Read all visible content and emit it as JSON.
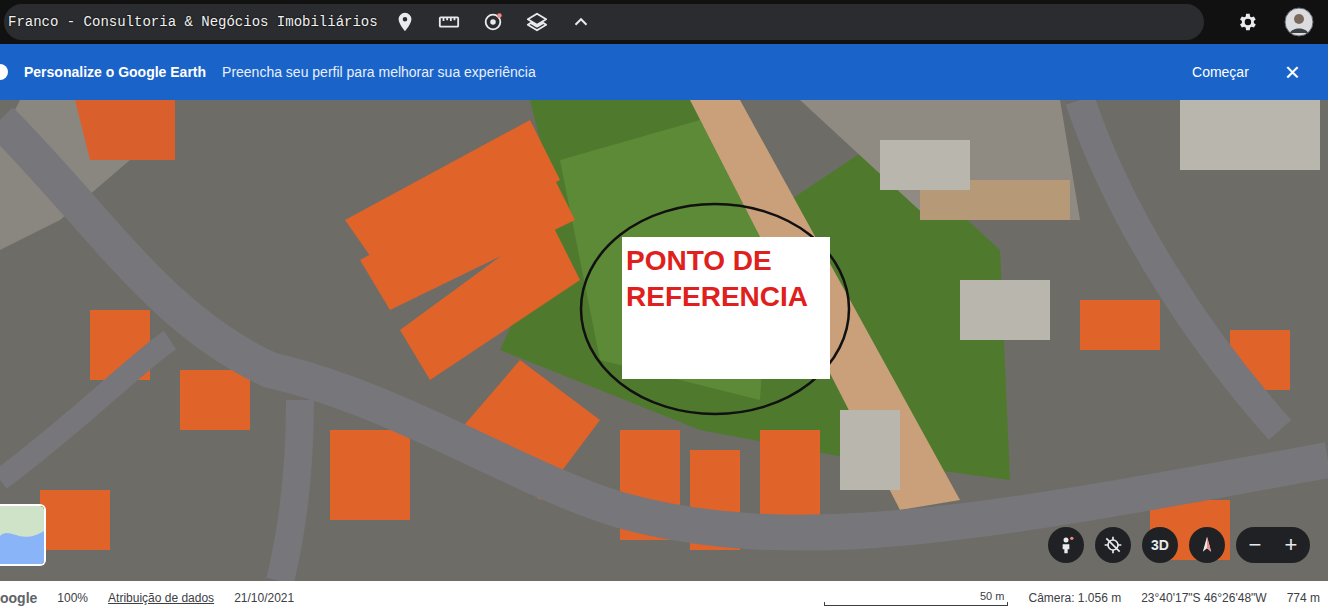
{
  "app_bar": {
    "search_text": "Franco - Consultoria & Negócios Imobiliários"
  },
  "banner": {
    "title": "Personalize o Google Earth",
    "message": "Preencha seu perfil para melhorar sua experiência",
    "action": "Começar",
    "close": "×"
  },
  "map": {
    "annotation": "PONTO DE REFERENCIA"
  },
  "controls": {
    "view_3d": "3D",
    "zoom_out": "−",
    "zoom_in": "+"
  },
  "status_bar": {
    "logo": "oogle",
    "zoom": "100%",
    "attribution": "Atribuição de dados",
    "date": "21/10/2021",
    "scale": "50 m",
    "camera": "Câmera: 1.056 m",
    "coordinates": "23°40'17\"S 46°26'48\"W",
    "elevation": "774 m"
  }
}
